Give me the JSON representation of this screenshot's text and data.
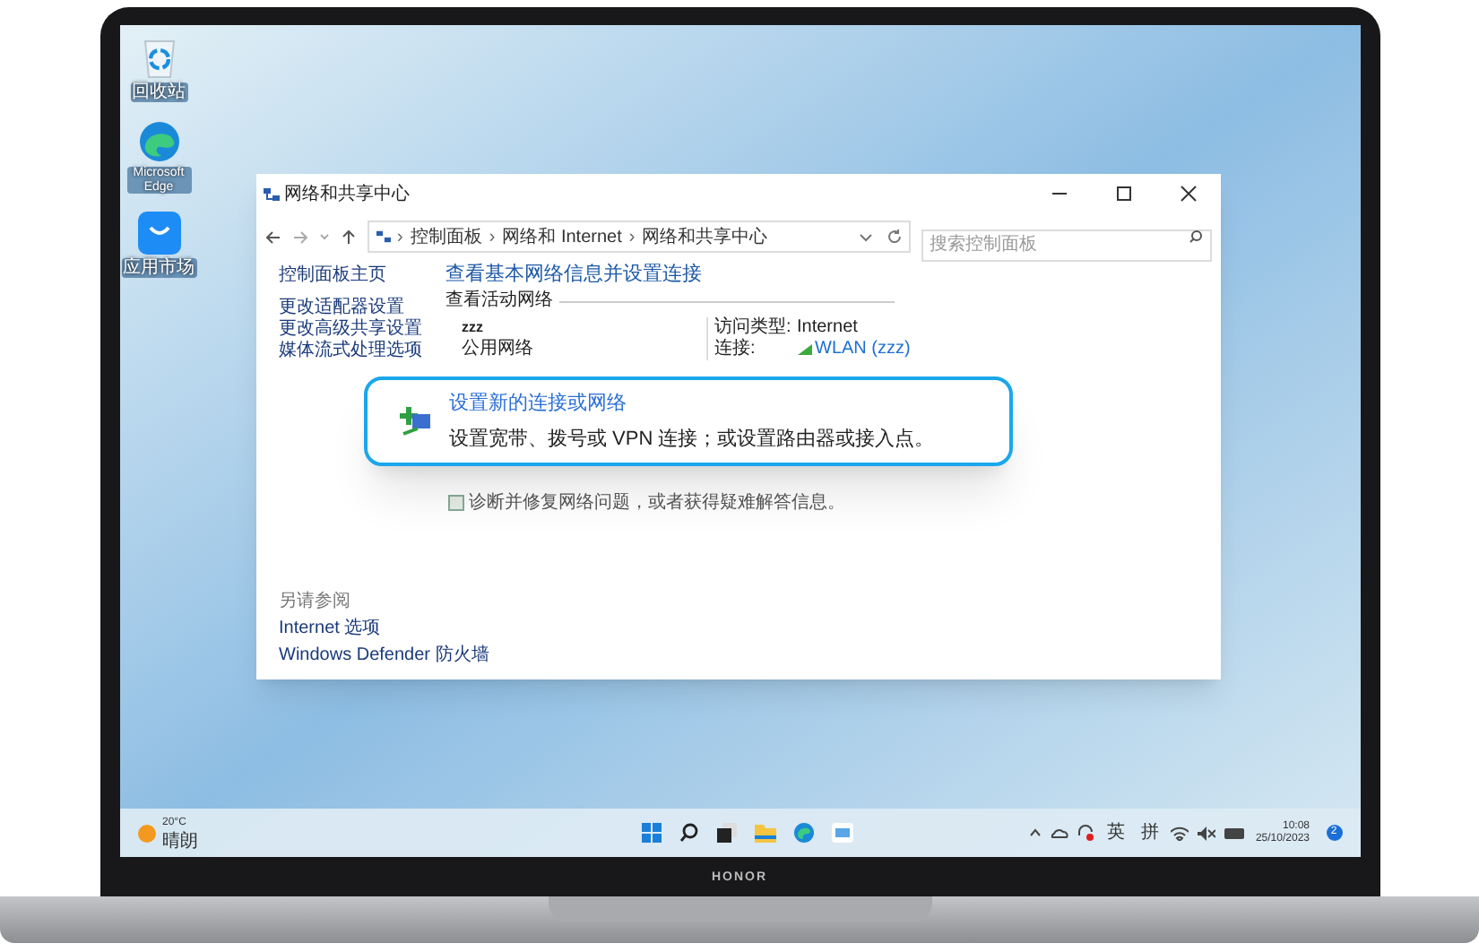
{
  "desktop_icons": [
    {
      "kind": "recycle",
      "label": "回收站"
    },
    {
      "kind": "edge",
      "label": "Microsoft Edge"
    },
    {
      "kind": "store",
      "label": "应用市场"
    }
  ],
  "window": {
    "title": "网络和共享中心",
    "breadcrumb": [
      {
        "separator": "›",
        "label": "控制面板"
      },
      {
        "separator": "›",
        "label": "网络和 Internet"
      },
      {
        "separator": "›",
        "label": "网络和共享中心"
      }
    ],
    "search": {
      "placeholder": "搜索控制面板"
    },
    "sidebar": {
      "items": [
        "控制面板主页",
        "更改适配器设置",
        "更改高级共享设置",
        "媒体流式处理选项"
      ],
      "see_also_heading": "另请参阅",
      "see_also": [
        "Internet 选项",
        "Windows Defender 防火墙"
      ]
    },
    "heading": "查看基本网络信息并设置连接",
    "active_networks_label": "查看活动网络",
    "network": {
      "name": "zzz",
      "type": "公用网络",
      "access_label": "访问类型:",
      "access_value": "Internet",
      "connection_label": "连接:",
      "connection_value": "WLAN (zzz)"
    },
    "troubleshoot_description": "诊断并修复网络问题，或者获得疑难解答信息。"
  },
  "callout": {
    "title": "设置新的连接或网络",
    "description": "设置宽带、拨号或 VPN 连接；或设置路由器或接入点。"
  },
  "taskbar": {
    "weather": {
      "temperature": "20°C",
      "condition": "晴朗"
    },
    "input_indicators": [
      "英",
      "拼"
    ],
    "time": "10:08",
    "date": "25/10/2023",
    "notification_count": "2"
  },
  "brand": "HONOR"
}
